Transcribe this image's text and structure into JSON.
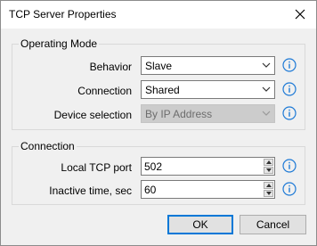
{
  "window": {
    "title": "TCP Server Properties"
  },
  "operating_mode": {
    "legend": "Operating Mode",
    "behavior": {
      "label": "Behavior",
      "value": "Slave"
    },
    "connection": {
      "label": "Connection",
      "value": "Shared"
    },
    "device_selection": {
      "label": "Device selection",
      "value": "By IP Address",
      "disabled": true
    }
  },
  "connection_group": {
    "legend": "Connection",
    "local_tcp_port": {
      "label": "Local TCP port",
      "value": "502"
    },
    "inactive_time": {
      "label": "Inactive time, sec",
      "value": "60"
    }
  },
  "buttons": {
    "ok": "OK",
    "cancel": "Cancel"
  },
  "icons": {
    "info_color": "#1e7ad6",
    "close": "close-icon",
    "info": "info-icon",
    "chevron": "chevron-down-icon"
  }
}
